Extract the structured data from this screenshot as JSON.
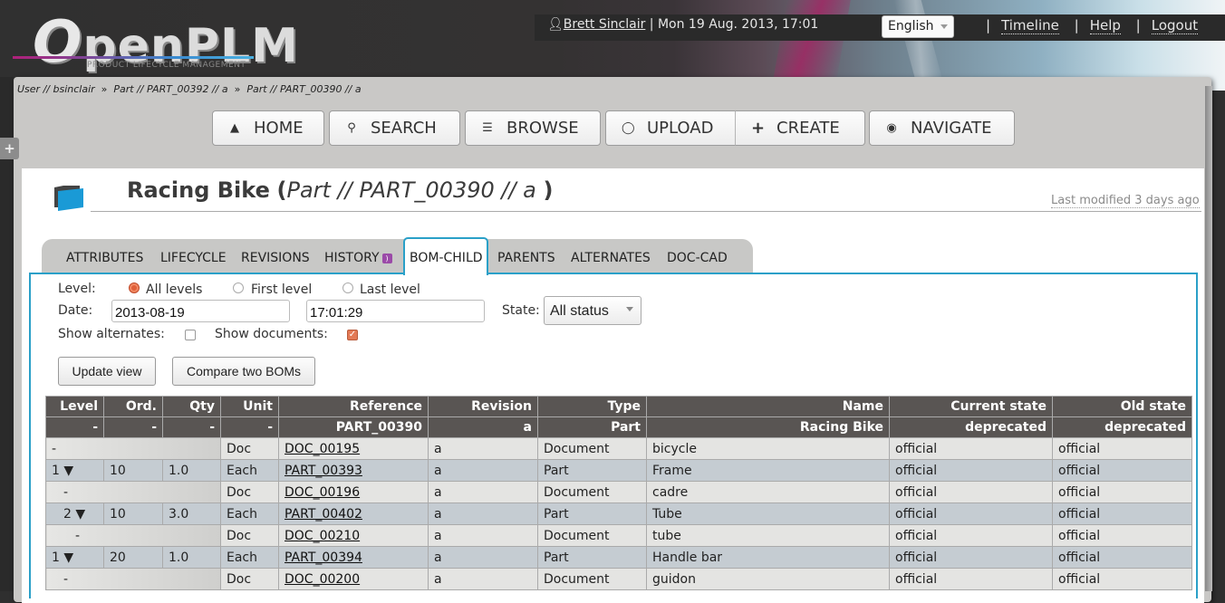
{
  "header": {
    "logo_text": "penPLM",
    "logo_o": "O",
    "logo_subtitle": "PRODUCT LIFECYCLE MANAGEMENT",
    "user_name": "Brett Sinclair",
    "datetime": "| Mon 19 Aug. 2013, 17:01",
    "language": "English",
    "links": [
      "Timeline",
      "Help",
      "Logout"
    ],
    "separator": "|"
  },
  "breadcrumb": [
    "User // bsinclair",
    "Part // PART_00392 // a",
    "Part // PART_00390 // a"
  ],
  "breadcrumb_sep": "»",
  "sidebar_toggle": "+",
  "nav": {
    "home": "HOME",
    "search": "SEARCH",
    "browse": "BROWSE",
    "upload": "UPLOAD",
    "create": "CREATE",
    "navigate": "NAVIGATE"
  },
  "object": {
    "name": "Racing Bike",
    "type_ref": "Part // PART_00390 //  a",
    "open_paren": "(",
    "close_paren": ")",
    "last_modified": "Last modified 3 days ago"
  },
  "tabs": [
    "ATTRIBUTES",
    "LIFECYCLE",
    "REVISIONS",
    "HISTORY",
    "BOM-CHILD",
    "PARENTS",
    "ALTERNATES",
    "DOC-CAD"
  ],
  "active_tab": "BOM-CHILD",
  "form": {
    "level_label": "Level:",
    "level_options": [
      "All levels",
      "First level",
      "Last level"
    ],
    "level_selected": "All levels",
    "date_label": "Date:",
    "date_value": "2013-08-19",
    "time_value": "17:01:29",
    "state_label": "State:",
    "state_value": "All status",
    "show_alternates_label": "Show alternates:",
    "show_alternates": false,
    "show_documents_label": "Show documents:",
    "show_documents": true,
    "update_button": "Update view",
    "compare_button": "Compare two BOMs"
  },
  "table": {
    "columns": [
      "Level",
      "Ord.",
      "Qty",
      "Unit",
      "Reference",
      "Revision",
      "Type",
      "Name",
      "Current state",
      "Old state"
    ],
    "root": [
      "-",
      "-",
      "-",
      "-",
      "PART_00390",
      "a",
      "Part",
      "Racing Bike",
      "deprecated",
      "deprecated"
    ],
    "rows": [
      {
        "kind": "doc",
        "level": "-",
        "indent": 0,
        "unit": "Doc",
        "reference": "DOC_00195",
        "revision": "a",
        "type": "Document",
        "name": "bicycle",
        "current": "official",
        "old": "official"
      },
      {
        "kind": "part",
        "level": "1 ▼",
        "indent": 0,
        "ord": "10",
        "qty": "1.0",
        "unit": "Each",
        "reference": "PART_00393",
        "revision": "a",
        "type": "Part",
        "name": "Frame",
        "current": "official",
        "old": "official"
      },
      {
        "kind": "doc",
        "level": "-",
        "indent": 1,
        "unit": "Doc",
        "reference": "DOC_00196",
        "revision": "a",
        "type": "Document",
        "name": "cadre",
        "current": "official",
        "old": "official"
      },
      {
        "kind": "part",
        "level": "2 ▼",
        "indent": 1,
        "ord": "10",
        "qty": "3.0",
        "unit": "Each",
        "reference": "PART_00402",
        "revision": "a",
        "type": "Part",
        "name": "Tube",
        "current": "official",
        "old": "official"
      },
      {
        "kind": "doc",
        "level": "-",
        "indent": 2,
        "unit": "Doc",
        "reference": "DOC_00210",
        "revision": "a",
        "type": "Document",
        "name": "tube",
        "current": "official",
        "old": "official"
      },
      {
        "kind": "part",
        "level": "1 ▼",
        "indent": 0,
        "ord": "20",
        "qty": "1.0",
        "unit": "Each",
        "reference": "PART_00394",
        "revision": "a",
        "type": "Part",
        "name": "Handle bar",
        "current": "official",
        "old": "official"
      },
      {
        "kind": "doc",
        "level": "-",
        "indent": 1,
        "unit": "Doc",
        "reference": "DOC_00200",
        "revision": "a",
        "type": "Document",
        "name": "guidon",
        "current": "official",
        "old": "official"
      }
    ]
  },
  "colors": {
    "accent": "#2aa0c8",
    "header_dark": "#595553",
    "part_row": "#c5ccd2",
    "doc_row": "#e4e4e2",
    "radio_checked": "#e0603a"
  }
}
